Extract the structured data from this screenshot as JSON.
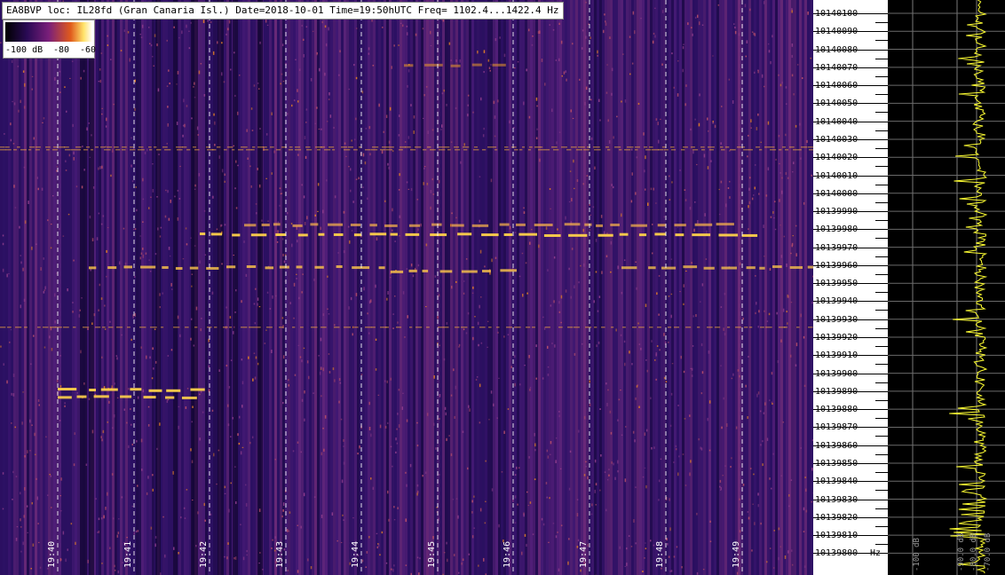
{
  "header": {
    "text": "EA8BVP loc: IL28fd (Gran Canaria Isl.) Date=2018-10-01 Time=19:50hUTC Freq= 1102.4...1422.4 Hz"
  },
  "legend": {
    "labels": [
      "-100 dB",
      "-80",
      "-60"
    ]
  },
  "time_axis": {
    "labels": [
      "19:40",
      "19:41",
      "19:42",
      "19:43",
      "19:44",
      "19:45",
      "19:46",
      "19:47",
      "19:48",
      "19:49"
    ]
  },
  "freq_axis": {
    "labels": [
      "10140100",
      "10140090",
      "10140080",
      "10140070",
      "10140060",
      "10140050",
      "10140040",
      "10140030",
      "10140020",
      "10140010",
      "10140000",
      "10139990",
      "10139980",
      "10139970",
      "10139960",
      "10139950",
      "10139940",
      "10139930",
      "10139920",
      "10139910",
      "10139900",
      "10139890",
      "10139880",
      "10139870",
      "10139860",
      "10139850",
      "10139840",
      "10139830",
      "10139820",
      "10139810",
      "10139800"
    ],
    "unit": "Hz"
  },
  "spectrum_axis": {
    "labels": [
      "-100 dB",
      "-90.0 dB",
      "-80.0 dB",
      "-70.0 dB"
    ]
  },
  "colors": {
    "background_dark": "#2a0f5c",
    "signal": "#ffcf3a",
    "spectrum_trace": "#ffff33"
  }
}
